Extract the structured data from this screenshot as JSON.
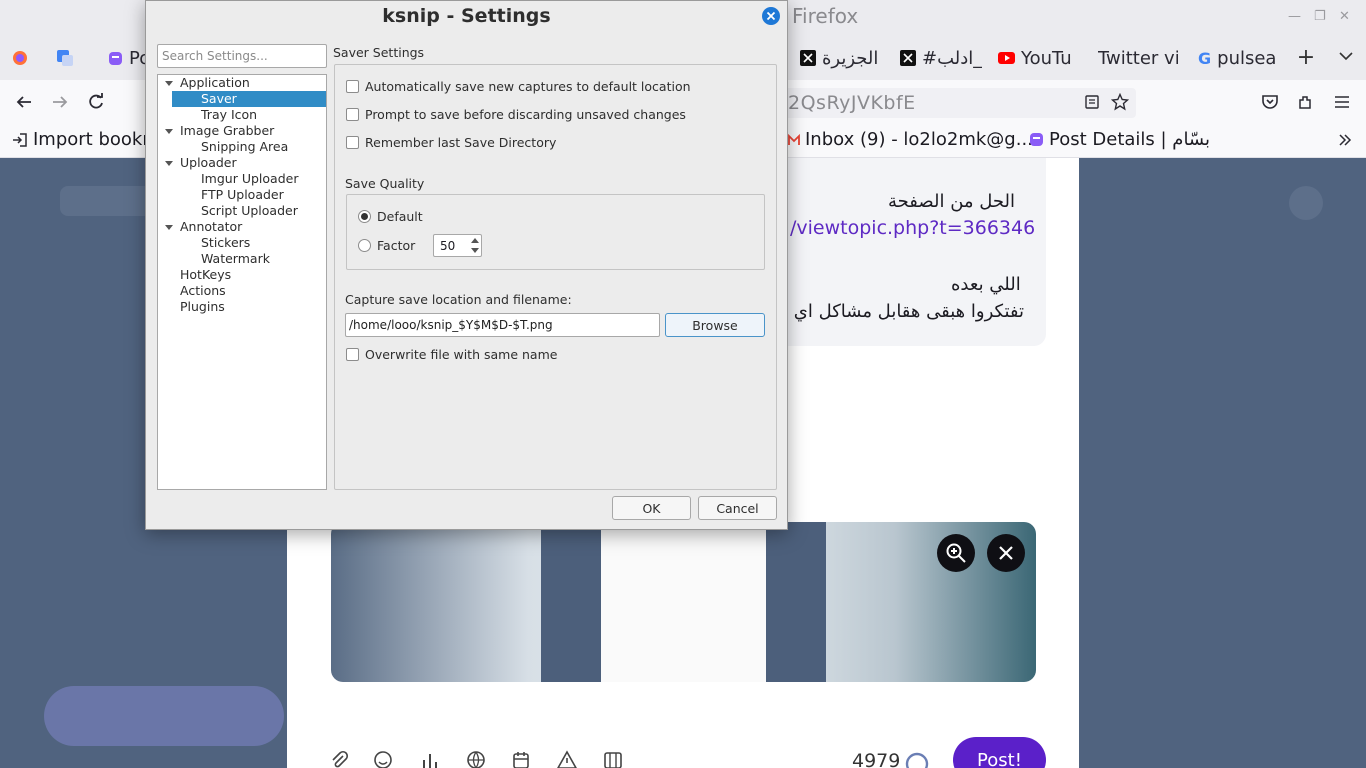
{
  "browser": {
    "title": "Firefox",
    "tabs": [
      {
        "label": "Po",
        "icon": "puzzle-icon"
      },
      {
        "label": "الجزيرة",
        "icon": "x-logo-icon"
      },
      {
        "label": "#ادلب_",
        "icon": "x-logo-icon"
      },
      {
        "label": "YouTu",
        "icon": "youtube-icon"
      },
      {
        "label": "Twitter vi",
        "icon": ""
      },
      {
        "label": "pulsea",
        "icon": "google-icon"
      }
    ],
    "url_fragment": "2QsRyJVKbfE",
    "bookmarks": {
      "import": "Import bookm",
      "inbox": "Inbox (9) - lo2lo2mk@g...",
      "post_details": "Post Details | بسّام"
    }
  },
  "page": {
    "line1": "الحل من الصفحة",
    "link": "/viewtopic.php?t=366346",
    "line2": "اللي بعده",
    "line3": "تفتكروا هبقى هقابل مشاكل اي",
    "char_count": "4979",
    "post_label": "Post!"
  },
  "dialog": {
    "title": "ksnip - Settings",
    "search_placeholder": "Search Settings...",
    "tree": {
      "application": "Application",
      "saver": "Saver",
      "tray_icon": "Tray Icon",
      "image_grabber": "Image Grabber",
      "snipping_area": "Snipping Area",
      "uploader": "Uploader",
      "imgur_uploader": "Imgur Uploader",
      "ftp_uploader": "FTP Uploader",
      "script_uploader": "Script Uploader",
      "annotator": "Annotator",
      "stickers": "Stickers",
      "watermark": "Watermark",
      "hotkeys": "HotKeys",
      "actions": "Actions",
      "plugins": "Plugins"
    },
    "section_title": "Saver Settings",
    "auto_save": "Automatically save new captures to default location",
    "prompt_save": "Prompt to save before discarding unsaved changes",
    "remember_dir": "Remember last Save Directory",
    "save_quality": "Save Quality",
    "quality_default": "Default",
    "quality_factor": "Factor",
    "factor_value": "50",
    "location_label": "Capture save location and filename:",
    "location_value": "/home/looo/ksnip_$Y$M$D-$T.png",
    "browse": "Browse",
    "overwrite": "Overwrite file with same name",
    "ok": "OK",
    "cancel": "Cancel"
  }
}
